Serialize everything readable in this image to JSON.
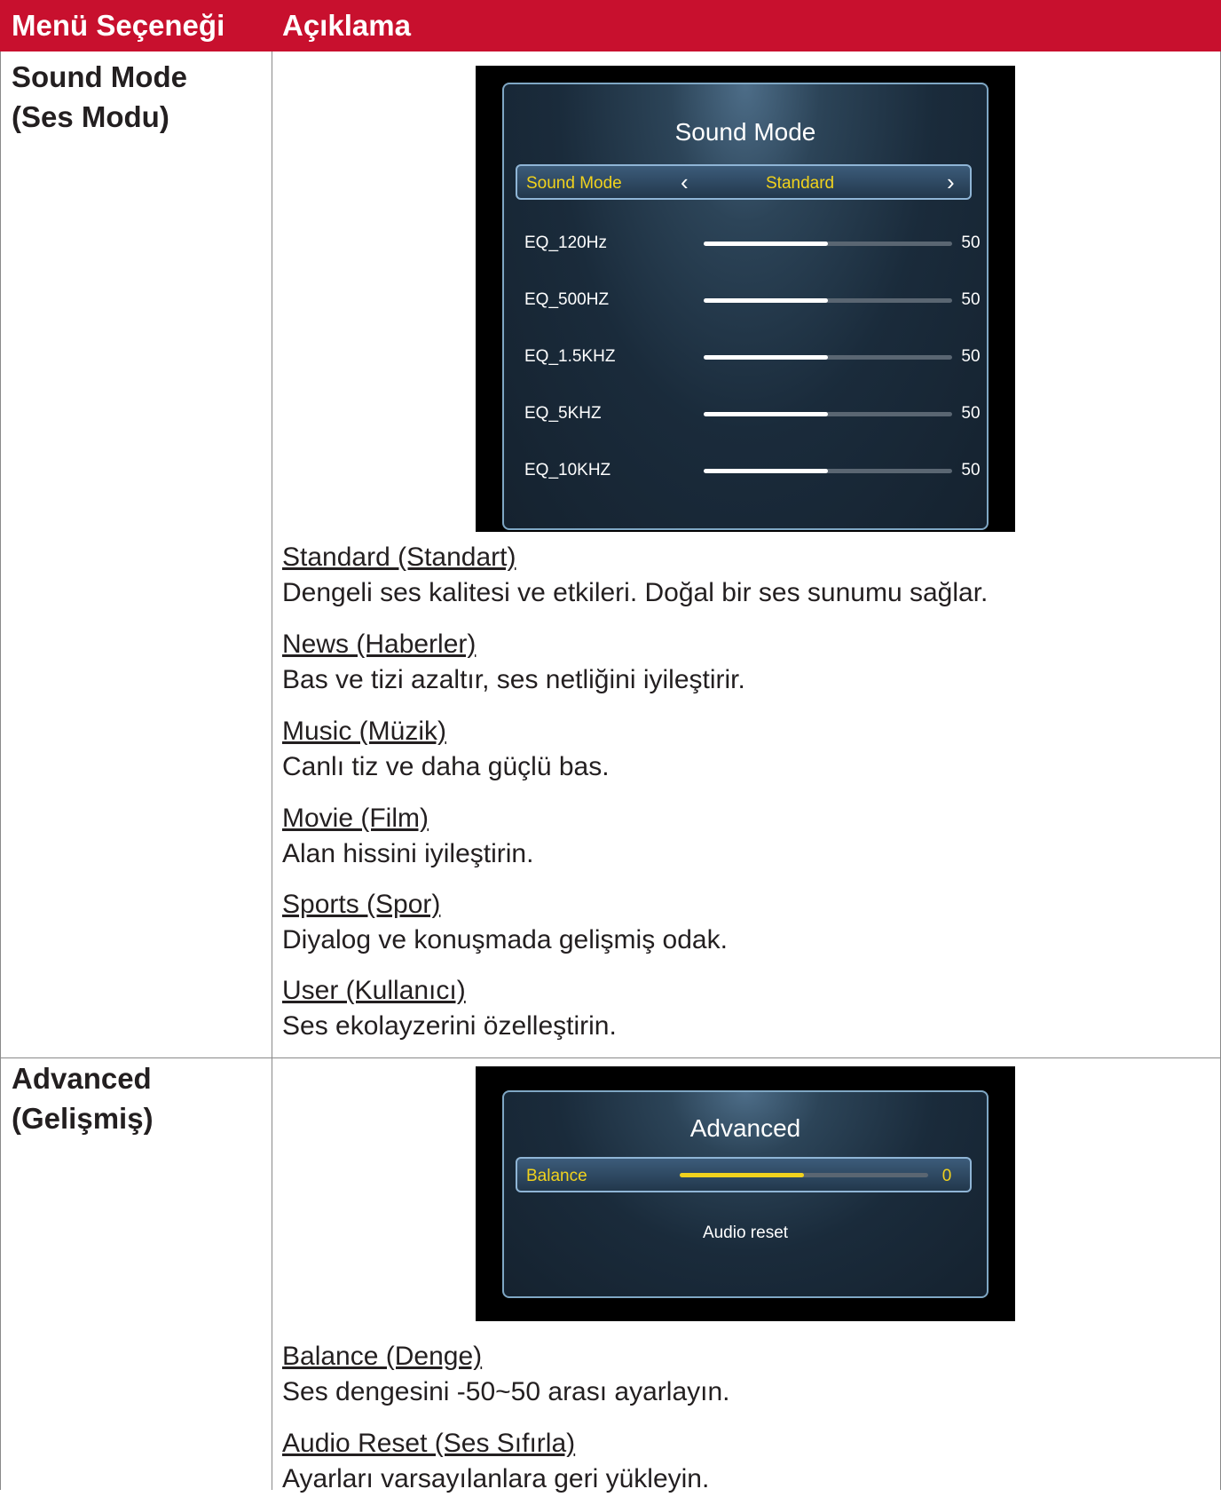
{
  "header": {
    "col1": "Menü Seçeneği",
    "col2": "Açıklama"
  },
  "colors": {
    "header_bg": "#c8102e",
    "osd_highlight": "#f1d21d",
    "osd_border": "#7fa7c4"
  },
  "rows": [
    {
      "name_line1": "Sound Mode",
      "name_line2": "(Ses Modu)",
      "osd": {
        "title": "Sound Mode",
        "selector": {
          "label": "Sound Mode",
          "value": "Standard",
          "left_icon": "chevron-left-icon",
          "right_icon": "chevron-right-icon"
        },
        "eq": [
          {
            "label": "EQ_120Hz",
            "value": "50",
            "level_percent": 50
          },
          {
            "label": "EQ_500HZ",
            "value": "50",
            "level_percent": 50
          },
          {
            "label": "EQ_1.5KHZ",
            "value": "50",
            "level_percent": 50
          },
          {
            "label": "EQ_5KHZ",
            "value": "50",
            "level_percent": 50
          },
          {
            "label": "EQ_10KHZ",
            "value": "50",
            "level_percent": 50
          }
        ]
      },
      "entries": [
        {
          "title": "Standard (Standart)",
          "desc": "Dengeli ses kalitesi ve etkileri. Doğal bir ses sunumu sağlar."
        },
        {
          "title": "News (Haberler)",
          "desc": "Bas ve tizi azaltır, ses netliğini iyileştirir."
        },
        {
          "title": "Music (Müzik)",
          "desc": "Canlı tiz ve daha güçlü bas."
        },
        {
          "title": "Movie (Film)",
          "desc": "Alan hissini iyileştirin."
        },
        {
          "title": "Sports (Spor)",
          "desc": "Diyalog ve konuşmada gelişmiş odak."
        },
        {
          "title": "User (Kullanıcı)",
          "desc": "Ses ekolayzerini özelleştirin."
        }
      ]
    },
    {
      "name_line1": "Advanced",
      "name_line2": "(Gelişmiş)",
      "osd": {
        "title": "Advanced",
        "balance": {
          "label": "Balance",
          "value": "0",
          "level_percent": 50
        },
        "audio_reset": "Audio reset"
      },
      "entries": [
        {
          "title": "Balance (Denge)",
          "desc": "Ses dengesini -50~50 arası ayarlayın."
        },
        {
          "title": "Audio Reset (Ses Sıfırla)",
          "desc": "Ayarları varsayılanlara geri yükleyin."
        }
      ]
    }
  ]
}
